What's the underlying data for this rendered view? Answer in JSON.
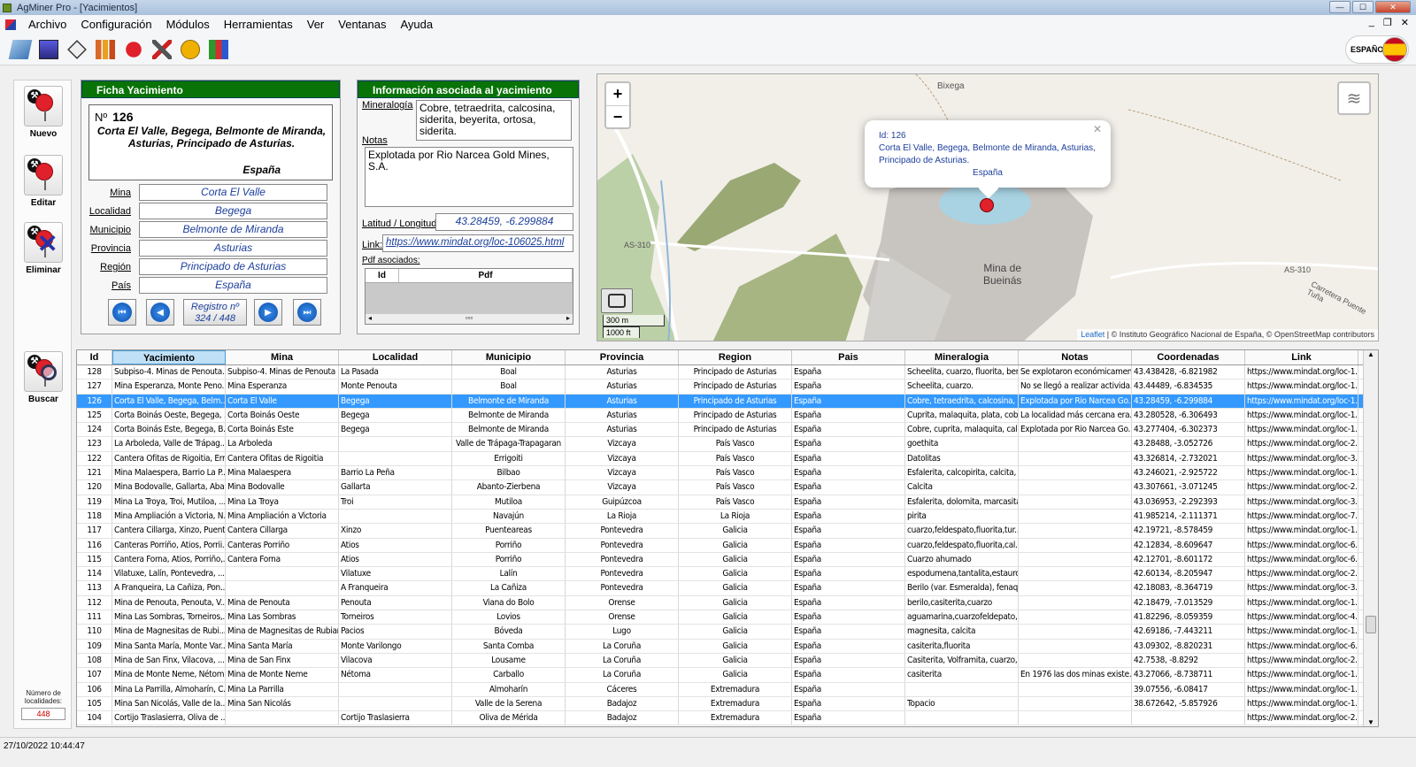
{
  "window": {
    "title": "AgMiner Pro - [Yacimientos]"
  },
  "menu": [
    "Archivo",
    "Configuración",
    "Módulos",
    "Herramientas",
    "Ver",
    "Ventanas",
    "Ayuda"
  ],
  "language": "ESPAÑOL",
  "toolbar_icons": [
    "map-icon",
    "chart-icon",
    "crystal-icon",
    "bar-chart-icon",
    "pick-pin-icon",
    "tools-icon",
    "miner-icon",
    "books-icon"
  ],
  "left": {
    "nuevo": "Nuevo",
    "editar": "Editar",
    "eliminar": "Eliminar",
    "buscar": "Buscar",
    "num_label": "Número de localidades:",
    "num_value": "448"
  },
  "ficha": {
    "title": "Ficha Yacimiento",
    "no_label": "Nº",
    "no": "126",
    "name": "Corta El Valle, Begega, Belmonte de Miranda, Asturias, Principado de Asturias.",
    "pais_big": "España",
    "fields": [
      {
        "label": "Mina",
        "value": "Corta El Valle"
      },
      {
        "label": "Localidad",
        "value": "Begega"
      },
      {
        "label": "Municipio",
        "value": "Belmonte de Miranda"
      },
      {
        "label": "Provincia",
        "value": "Asturias"
      },
      {
        "label": "Región",
        "value": "Principado de Asturias"
      },
      {
        "label": "País",
        "value": "España"
      }
    ],
    "registro": "Registro nº",
    "registro_val": "324 / 448"
  },
  "info": {
    "title": "Información asociada al yacimiento",
    "mineralogia_label": "Mineralogía",
    "mineralogia": "Cobre, tetraedrita, calcosina, siderita, beyerita, ortosa, siderita.",
    "notas_label": "Notas",
    "notas": "Explotada por Rio Narcea Gold Mines, S.A.",
    "latlon_label": "Latitud / Longitud:",
    "latlon": "43.28459, -6.299884",
    "link_label": "Link:",
    "link": "https://www.mindat.org/loc-106025.html",
    "pdf_label": "Pdf asociados:",
    "pdf_cols": [
      "Id",
      "Pdf"
    ]
  },
  "map": {
    "popup": {
      "id": "Id: 126",
      "line1": "Corta El Valle, Begega, Belmonte de Miranda, Asturias,",
      "line2": "Principado de Asturias.",
      "country": "España"
    },
    "labels": {
      "bixega": "Bixega",
      "as310a": "AS-310",
      "as310b": "AS-310",
      "mina1": "Mina de",
      "mina2": "Bueinás",
      "carretera": "Carretera Puente Tuña"
    },
    "scale_m": "300 m",
    "scale_ft": "1000 ft",
    "attribution_link": "Leaflet",
    "attribution_rest": " | © Instituto Geográfico Nacional de España, © OpenStreetMap contributors"
  },
  "table": {
    "columns": [
      "Id",
      "Yacimiento",
      "Mina",
      "Localidad",
      "Municipio",
      "Provincia",
      "Region",
      "Pais",
      "Mineralogia",
      "Notas",
      "Coordenadas",
      "Link"
    ],
    "selected_id": "126",
    "rows": [
      [
        "128",
        "Subpiso-4. Minas de Penouta...",
        "Subpiso-4. Minas de Penouta",
        "La Pasada",
        "Boal",
        "Asturias",
        "Principado de Asturias",
        "España",
        "Scheelita, cuarzo, fluorita, ber...",
        "Se explotaron económicamen...",
        "43.438428, -6.821982",
        "https://www.mindat.org/loc-1..."
      ],
      [
        "127",
        "Mina Esperanza, Monte Peno...",
        "Mina Esperanza",
        "Monte Penouta",
        "Boal",
        "Asturias",
        "Principado de Asturias",
        "España",
        "Scheelita, cuarzo.",
        "No se llegó a realizar activida...",
        "43.44489, -6.834535",
        "https://www.mindat.org/loc-1..."
      ],
      [
        "126",
        "Corta El Valle, Begega, Belm...",
        "Corta El Valle",
        "Begega",
        "Belmonte de Miranda",
        "Asturias",
        "Principado de Asturias",
        "España",
        "Cobre, tetraedrita, calcosina, ...",
        "Explotada por Rio Narcea Go...",
        "43.28459, -6.299884",
        "https://www.mindat.org/loc-1..."
      ],
      [
        "125",
        "Corta Boinás Oeste, Begega, ...",
        "Corta Boinás Oeste",
        "Begega",
        "Belmonte de Miranda",
        "Asturias",
        "Principado de Asturias",
        "España",
        "Cuprita, malaquita, plata, cobr...",
        "La localidad más cercana era...",
        "43.280528, -6.306493",
        "https://www.mindat.org/loc-1..."
      ],
      [
        "124",
        "Corta Boinás Este, Begega, B...",
        "Corta Boinás Este",
        "Begega",
        "Belmonte de Miranda",
        "Asturias",
        "Principado de Asturias",
        "España",
        "Cobre, cuprita, malaquita, cal...",
        "Explotada por Rio Narcea Go...",
        "43.277404, -6.302373",
        "https://www.mindat.org/loc-1..."
      ],
      [
        "123",
        "La Arboleda, Valle de Trápag...",
        "La Arboleda",
        "",
        "Valle de Trápaga-Trapagaran",
        "Vizcaya",
        "País Vasco",
        "España",
        "goethita",
        "",
        "43.28488, -3.052726",
        "https://www.mindat.org/loc-2..."
      ],
      [
        "122",
        "Cantera Ofitas de Rigoitia, Err...",
        "Cantera Ofitas de Rigoitia",
        "",
        "Errigoiti",
        "Vizcaya",
        "País Vasco",
        "España",
        "Datolitas",
        "",
        "43.326814, -2.732021",
        "https://www.mindat.org/loc-3..."
      ],
      [
        "121",
        "Mina Malaespera, Barrio La P...",
        "Mina Malaespera",
        "Barrio La Peña",
        "Bilbao",
        "Vizcaya",
        "País Vasco",
        "España",
        "Esfalerita, calcopirita, calcita, ...",
        "",
        "43.246021, -2.925722",
        "https://www.mindat.org/loc-1..."
      ],
      [
        "120",
        "Mina Bodovalle, Gallarta, Aba...",
        "Mina Bodovalle",
        "Gallarta",
        "Abanto-Zierbena",
        "Vizcaya",
        "País Vasco",
        "España",
        "Calcita",
        "",
        "43.307661, -3.071245",
        "https://www.mindat.org/loc-2..."
      ],
      [
        "119",
        "Mina La Troya, Troi, Mutiloa, ...",
        "Mina La Troya",
        "Troi",
        "Mutiloa",
        "Guipúzcoa",
        "País Vasco",
        "España",
        "Esfalerita, dolomita, marcasita",
        "",
        "43.036953, -2.292393",
        "https://www.mindat.org/loc-3..."
      ],
      [
        "118",
        "Mina Ampliación a Victoria, N...",
        "Mina Ampliación a Victoria",
        "",
        "Navajún",
        "La Rioja",
        "La Rioja",
        "España",
        "pirita",
        "",
        "41.985214, -2.111371",
        "https://www.mindat.org/loc-7..."
      ],
      [
        "117",
        "Cantera Cillarga, Xinzo, Puent...",
        "Cantera Cillarga",
        "Xinzo",
        "Puenteareas",
        "Pontevedra",
        "Galicia",
        "España",
        "cuarzo,feldespato,fluorita,tur...",
        "",
        "42.19721, -8.578459",
        "https://www.mindat.org/loc-1..."
      ],
      [
        "116",
        "Canteras Porriño, Atios, Porrii...",
        "Canteras Porriño",
        "Atios",
        "Porriño",
        "Pontevedra",
        "Galicia",
        "España",
        "cuarzo,feldespato,fluorita,cal...",
        "",
        "42.12834, -8.609647",
        "https://www.mindat.org/loc-6..."
      ],
      [
        "115",
        "Cantera Forna, Atios, Porriño,...",
        "Cantera Forna",
        "Atios",
        "Porriño",
        "Pontevedra",
        "Galicia",
        "España",
        "Cuarzo ahumado",
        "",
        "42.12701, -8.601172",
        "https://www.mindat.org/loc-6..."
      ],
      [
        "114",
        "Vilatuxe, Lalín, Pontevedra, ...",
        "",
        "Vilatuxe",
        "Lalín",
        "Pontevedra",
        "Galicia",
        "España",
        "espodumena,tantalita,estauro...",
        "",
        "42.60134, -8.205947",
        "https://www.mindat.org/loc-2..."
      ],
      [
        "113",
        "A Franqueira, La Cañiza, Pon...",
        "",
        "A Franqueira",
        "La Cañiza",
        "Pontevedra",
        "Galicia",
        "España",
        "Berilo (var. Esmeralda), fenaq...",
        "",
        "42.18083, -8.364719",
        "https://www.mindat.org/loc-3..."
      ],
      [
        "112",
        "Mina de Penouta, Penouta, V...",
        "Mina de Penouta",
        "Penouta",
        "Viana do Bolo",
        "Orense",
        "Galicia",
        "España",
        "berilo,casiterita,cuarzo",
        "",
        "42.18479, -7.013529",
        "https://www.mindat.org/loc-1..."
      ],
      [
        "111",
        "Mina Las Sombras, Torneiros,...",
        "Mina Las Sombras",
        "Torneiros",
        "Lovios",
        "Orense",
        "Galicia",
        "España",
        "aguamarina,cuarzofeldepato,...",
        "",
        "41.82296, -8.059359",
        "https://www.mindat.org/loc-4..."
      ],
      [
        "110",
        "Mina de Magnesitas de Rubi...",
        "Mina de Magnesitas de Rubian",
        "Pacios",
        "Bóveda",
        "Lugo",
        "Galicia",
        "España",
        "magnesita, calcita",
        "",
        "42.69186, -7.443211",
        "https://www.mindat.org/loc-1..."
      ],
      [
        "109",
        "Mina Santa María, Monte Var...",
        "Mina Santa María",
        "Monte Varilongo",
        "Santa Comba",
        "La Coruña",
        "Galicia",
        "España",
        "casiterita,fluorita",
        "",
        "43.09302, -8.820231",
        "https://www.mindat.org/loc-6..."
      ],
      [
        "108",
        "Mina de San Finx, Vilacova, ...",
        "Mina de San Finx",
        "Vilacova",
        "Lousame",
        "La Coruña",
        "Galicia",
        "España",
        "Casiterita, Volframita, cuarzo, ...",
        "",
        "42.7538, -8.8292",
        "https://www.mindat.org/loc-2..."
      ],
      [
        "107",
        "Mina de Monte Neme, Nétom...",
        "Mina de Monte Neme",
        "Nétoma",
        "Carballo",
        "La Coruña",
        "Galicia",
        "España",
        "casiterita",
        "En 1976 las dos minas existe...",
        "43.27066, -8.738711",
        "https://www.mindat.org/loc-1..."
      ],
      [
        "106",
        "Mina La Parrilla, Almoharín, C...",
        "Mina La Parrilla",
        "",
        "Almoharín",
        "Cáceres",
        "Extremadura",
        "España",
        "",
        "",
        "39.07556, -6.08417",
        "https://www.mindat.org/loc-1..."
      ],
      [
        "105",
        "Mina San Nicolás, Valle de la...",
        "Mina San Nicolás",
        "",
        "Valle de la Serena",
        "Badajoz",
        "Extremadura",
        "España",
        "Topacio",
        "",
        "38.672642, -5.857926",
        "https://www.mindat.org/loc-1..."
      ],
      [
        "104",
        "Cortijo Traslasierra, Oliva de ...",
        "",
        "Cortijo Traslasierra",
        "Oliva de Mérida",
        "Badajoz",
        "Extremadura",
        "España",
        "",
        "",
        "",
        "https://www.mindat.org/loc-2..."
      ]
    ]
  },
  "status": {
    "datetime": "27/10/2022 10:44:47"
  }
}
